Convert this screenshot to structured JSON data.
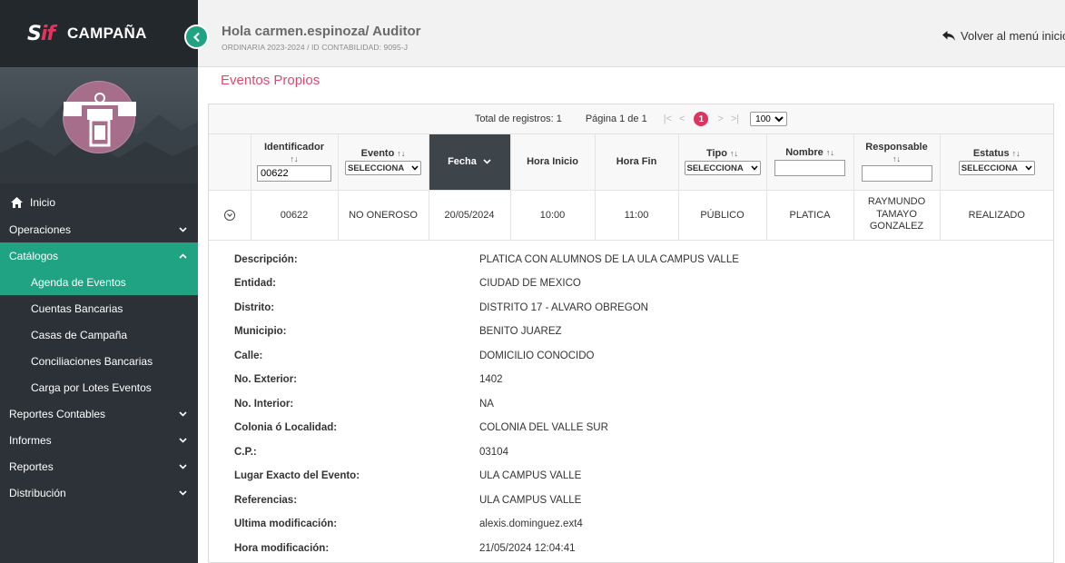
{
  "brand": {
    "logo_s": "S",
    "logo_if": "if",
    "title": "CAMPAÑA"
  },
  "header": {
    "greeting": "Hola carmen.espinoza/ Auditor",
    "subheading": "ORDINARIA 2023-2024 / ID CONTABILIDAD: 9095-J",
    "back_label": "Volver al menú inicio"
  },
  "sidebar": {
    "home": "Inicio",
    "items": [
      {
        "label": "Operaciones",
        "icon": "chevron-down-icon"
      },
      {
        "label": "Catálogos",
        "icon": "chevron-up-icon"
      },
      {
        "label": "Reportes Contables",
        "icon": "chevron-down-icon"
      },
      {
        "label": "Informes",
        "icon": "chevron-down-icon"
      },
      {
        "label": "Reportes",
        "icon": "chevron-down-icon"
      },
      {
        "label": "Distribución",
        "icon": "chevron-down-icon"
      }
    ],
    "catalogos_sub": [
      "Agenda de Eventos",
      "Cuentas Bancarias",
      "Casas de Campaña",
      "Conciliaciones Bancarias",
      "Carga por Lotes Eventos"
    ]
  },
  "main": {
    "title": "Eventos Propios",
    "paginator": {
      "total": "Total de registros: 1",
      "page_info": "Página 1 de 1",
      "first": "|<",
      "prev": "<",
      "current": "1",
      "next": ">",
      "last": ">|",
      "page_size": "100"
    },
    "columns": {
      "identificador": "Identificador",
      "evento": "Evento",
      "fecha": "Fecha",
      "hora_inicio": "Hora Inicio",
      "hora_fin": "Hora Fin",
      "tipo": "Tipo",
      "nombre": "Nombre",
      "responsable": "Responsable",
      "estatus": "Estatus"
    },
    "filters": {
      "identificador": "00622",
      "evento": "SELECCIONA",
      "tipo": "SELECCIONA",
      "estatus": "SELECCIONA",
      "nombre": "",
      "responsable": ""
    },
    "row": {
      "identificador": "00622",
      "evento": "NO ONEROSO",
      "fecha": "20/05/2024",
      "hora_inicio": "10:00",
      "hora_fin": "11:00",
      "tipo": "PÚBLICO",
      "nombre": "PLATICA",
      "responsable": "RAYMUNDO TAMAYO GONZALEZ",
      "estatus": "REALIZADO"
    },
    "detail": [
      {
        "label": "Descripción:",
        "value": "PLATICA CON ALUMNOS DE LA ULA CAMPUS VALLE"
      },
      {
        "label": "Entidad:",
        "value": "CIUDAD DE MEXICO"
      },
      {
        "label": "Distrito:",
        "value": "DISTRITO 17 - ALVARO OBREGON"
      },
      {
        "label": "Municipio:",
        "value": "BENITO JUAREZ"
      },
      {
        "label": "Calle:",
        "value": "DOMICILIO CONOCIDO"
      },
      {
        "label": "No. Exterior:",
        "value": "1402"
      },
      {
        "label": "No. Interior:",
        "value": "NA"
      },
      {
        "label": "Colonia ó Localidad:",
        "value": "COLONIA DEL VALLE SUR"
      },
      {
        "label": "C.P.:",
        "value": "03104"
      },
      {
        "label": "Lugar Exacto del Evento:",
        "value": "ULA CAMPUS VALLE"
      },
      {
        "label": "Referencias:",
        "value": "ULA CAMPUS VALLE"
      },
      {
        "label": "Ultima modificación:",
        "value": "alexis.dominguez.ext4"
      },
      {
        "label": "Hora modificación:",
        "value": "21/05/2024 12:04:41"
      }
    ]
  },
  "colors": {
    "accent": "#20a382",
    "brand_pink": "#e0335f",
    "title_pink": "#e0476f",
    "sidebar_bg": "#2c3237"
  }
}
